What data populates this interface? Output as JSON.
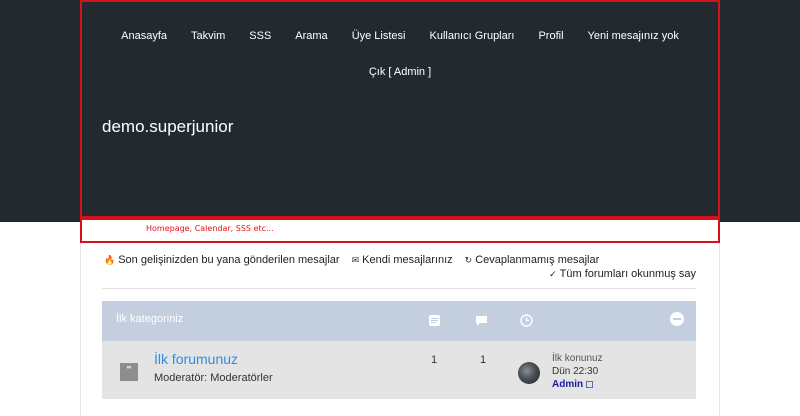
{
  "nav": {
    "items": [
      "Anasayfa",
      "Takvim",
      "SSS",
      "Arama",
      "Üye Listesi",
      "Kullanıcı Grupları",
      "Profil",
      "Yeni mesajınız yok"
    ],
    "logout": "Çık [ Admin ]"
  },
  "site": {
    "title": "demo.superjunior"
  },
  "annotation": {
    "text": "Homepage, Calendar, SSS etc..."
  },
  "quick_links": {
    "new_posts": "Son gelişinizden bu yana gönderilen mesajlar",
    "own_posts": "Kendi mesajlarınız",
    "unanswered": "Cevaplanmamış mesajlar",
    "mark_read": "Tüm forumları okunmuş say"
  },
  "category": {
    "title": "İlk kategoriniz"
  },
  "forum": {
    "name": "İlk forumunuz",
    "moderator_label": "Moderatör:",
    "moderator": "Moderatörler",
    "topics": "1",
    "posts": "1",
    "last_topic": "İlk konunuz",
    "last_time": "Dün 22:30",
    "last_author": "Admin"
  },
  "colors": {
    "header_bg": "#232a2f",
    "highlight_border": "#d8101c",
    "category_bg": "#c3cedf",
    "forum_row_bg": "#e4e4e4",
    "link": "#2b8ee6"
  },
  "icons": [
    "fire-icon",
    "chat-icon",
    "refresh-icon",
    "check-circle-icon",
    "topics-icon",
    "posts-icon",
    "clock-icon",
    "minus-circle-icon",
    "forum-icon",
    "goto-post-icon"
  ]
}
